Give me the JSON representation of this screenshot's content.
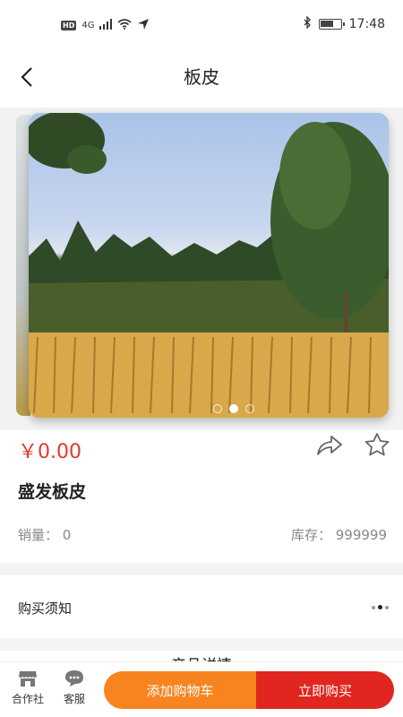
{
  "status_bar": {
    "hd_label": "HD",
    "network_label": "4G",
    "time": "17:48",
    "battery_level": 0.7,
    "icons": [
      "signal-icon",
      "wifi-icon",
      "location-icon",
      "bluetooth-icon",
      "battery-icon"
    ]
  },
  "nav": {
    "title": "板皮",
    "back_icon": "chevron-left-icon"
  },
  "carousel": {
    "page_count": 3,
    "active_index": 1
  },
  "product": {
    "price": "￥0.00",
    "name": "盛发板皮",
    "sales_label": "销量：",
    "sales_value": "0",
    "stock_label": "库存：",
    "stock_value": "999999"
  },
  "notice": {
    "label": "购买须知"
  },
  "detail": {
    "title": "产品详情"
  },
  "bottom_bar": {
    "coop_label": "合作社",
    "service_label": "客服",
    "add_cart_label": "添加购物车",
    "buy_now_label": "立即购买"
  },
  "colors": {
    "price": "#e03a2f",
    "cart_button": "#f7841e",
    "buy_button": "#e0261f"
  }
}
